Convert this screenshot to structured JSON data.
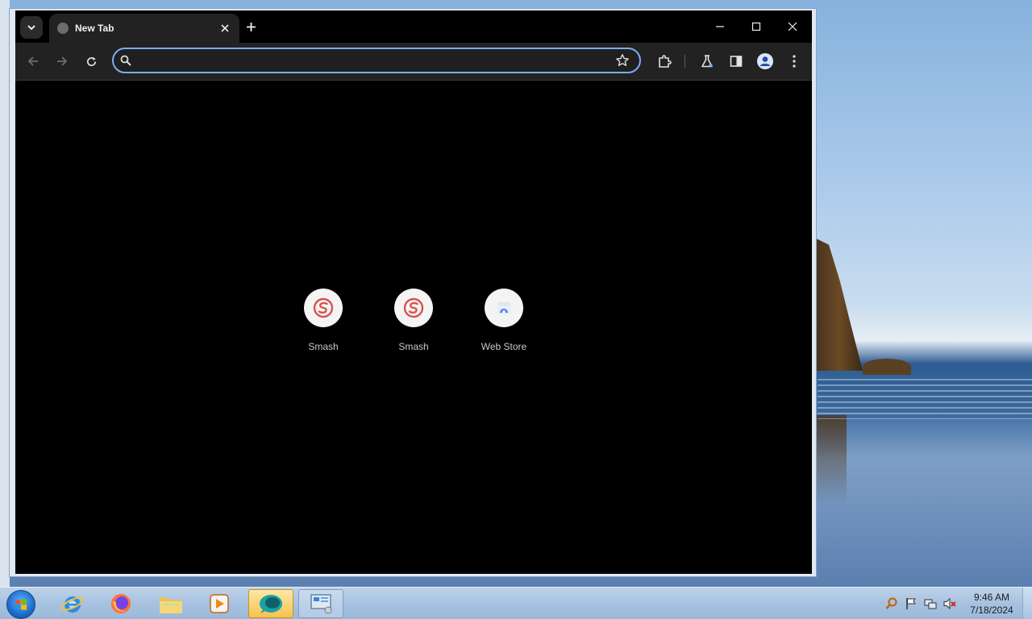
{
  "browser": {
    "tab": {
      "title": "New Tab"
    },
    "omnibox": {
      "value": "",
      "placeholder": ""
    },
    "shortcuts": [
      {
        "label": "Smash",
        "icon": "smash-logo-icon"
      },
      {
        "label": "Smash",
        "icon": "smash-logo-icon"
      },
      {
        "label": "Web Store",
        "icon": "web-store-icon"
      }
    ],
    "colors": {
      "background": "#000000",
      "toolbar": "#222222",
      "omnibox_focus": "#7cacf8",
      "smash_red": "#d9534f"
    }
  },
  "taskbar": {
    "clock": {
      "time": "9:46 AM",
      "date": "7/18/2024"
    },
    "apps": [
      "internet-explorer-icon",
      "firefox-icon",
      "file-explorer-icon",
      "media-player-icon",
      "active-app-icon",
      "control-panel-icon"
    ]
  }
}
